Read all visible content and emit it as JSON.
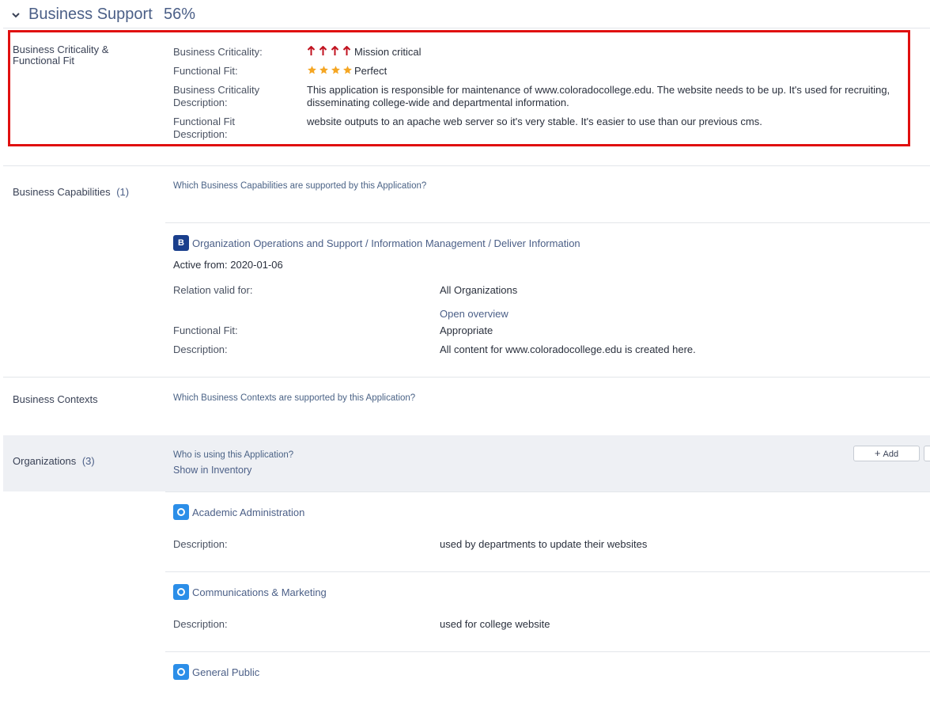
{
  "section": {
    "title": "Business Support",
    "percent": "56%"
  },
  "criticality": {
    "side_label": "Business Criticality & Functional Fit",
    "business_criticality_label": "Business Criticality:",
    "business_criticality_level": 4,
    "business_criticality_value": "Mission critical",
    "functional_fit_label": "Functional Fit:",
    "functional_fit_rating": 4,
    "functional_fit_value": "Perfect",
    "criticality_desc_label": "Business Criticality Description:",
    "criticality_desc_value": "This application is responsible for maintenance of www.coloradocollege.edu. The website needs to be up. It's used for recruiting, disseminating college-wide and departmental information.",
    "fit_desc_label": "Functional Fit Description:",
    "fit_desc_value": "website outputs to an apache web server so it's very stable. It's easier to use than our previous cms."
  },
  "capabilities": {
    "side_label": "Business Capabilities",
    "count": "(1)",
    "hint": "Which Business Capabilities are supported by this Application?",
    "item": {
      "badge": "B",
      "path": "Organization Operations and Support / Information Management / Deliver Information",
      "active_from": "Active from: 2020-01-06",
      "relation_label": "Relation valid for:",
      "relation_value": "All Organizations",
      "open_overview": "Open overview",
      "functional_fit_label": "Functional Fit:",
      "functional_fit_value": "Appropriate",
      "description_label": "Description:",
      "description_value": "All content for www.coloradocollege.edu is created here."
    }
  },
  "contexts": {
    "side_label": "Business Contexts",
    "hint": "Which Business Contexts are supported by this Application?"
  },
  "organizations": {
    "side_label": "Organizations",
    "count": "(3)",
    "hint": "Who is using this Application?",
    "show_inventory": "Show in Inventory",
    "add_label": "Add",
    "items": [
      {
        "name": "Academic Administration",
        "description_label": "Description:",
        "description_value": "used by departments to update their websites"
      },
      {
        "name": "Communications & Marketing",
        "description_label": "Description:",
        "description_value": "used for college website"
      },
      {
        "name": "General Public"
      }
    ]
  },
  "colors": {
    "accent": "#4b5f87",
    "highlight": "#e01010",
    "arrow": "#c1121f",
    "star": "#f5a623",
    "badge_b": "#1a3f8c",
    "badge_o": "#2b8ee8"
  }
}
